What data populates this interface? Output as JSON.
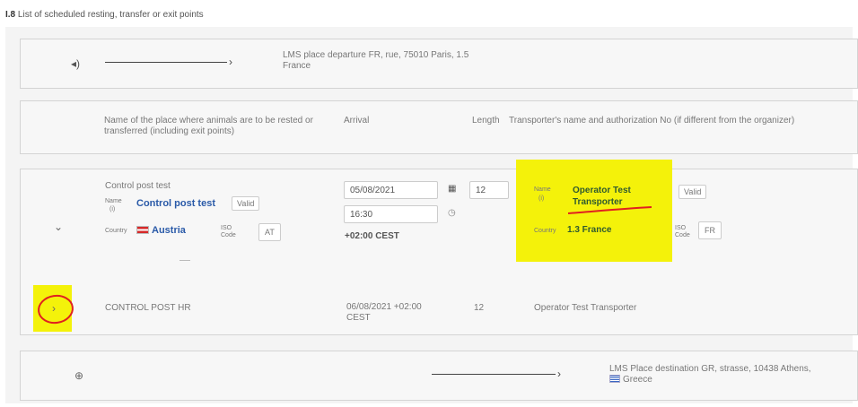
{
  "section": {
    "number": "I.8",
    "title": "List of scheduled resting, transfer or exit points"
  },
  "departure": {
    "text_line1": "LMS place departure FR, rue, 75010 Paris, 1.5",
    "text_line2": "France"
  },
  "headers": {
    "place": "Name of the place where animals are to be rested or transferred (including exit points)",
    "arrival": "Arrival",
    "length": "Length",
    "transporter": "Transporter's name and authorization No (if different from the organizer)"
  },
  "expanded_row": {
    "title": "Control post test",
    "name_label": "Name",
    "name_info": "(i)",
    "name_value": "Control post test",
    "name_status": "Valid",
    "country_label": "Country",
    "country_value": "Austria",
    "iso_label": "ISO Code",
    "iso_value": "AT",
    "arrival_date": "05/08/2021",
    "arrival_time": "16:30",
    "timezone": "+02:00 CEST",
    "length": "12",
    "transporter_name_label": "Name",
    "transporter_name_info": "(i)",
    "transporter_name_line1": "Operator Test",
    "transporter_name_line2": "Transporter",
    "transporter_status": "Valid",
    "transporter_country_label": "Country",
    "transporter_country": "1.3 France",
    "transporter_iso_label": "ISO Code",
    "transporter_iso": "FR"
  },
  "collapsed_row": {
    "place": "CONTROL POST HR",
    "arrival_line1": "06/08/2021 +02:00",
    "arrival_line2": "CEST",
    "length": "12",
    "transporter": "Operator Test Transporter"
  },
  "destination": {
    "text_line1": "LMS Place destination GR, strasse, 10438 Athens,",
    "text_line2": "Greece"
  },
  "icons": {
    "departure": "truck-departure-icon",
    "destination": "target-icon",
    "collapse": "chevron-down-icon",
    "expand": "chevron-right-icon",
    "calendar": "calendar-icon",
    "clock": "clock-icon"
  },
  "colors": {
    "highlight": "#f4f20a",
    "link": "#2a5aa8",
    "annotation": "#e02020"
  }
}
